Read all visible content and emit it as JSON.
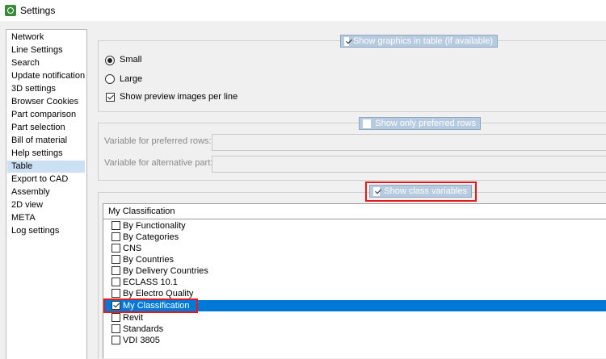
{
  "window": {
    "title": "Settings",
    "icon": "settings-gear-icon"
  },
  "sidebar": {
    "items": [
      {
        "label": "Network"
      },
      {
        "label": "Line Settings"
      },
      {
        "label": "Search"
      },
      {
        "label": "Update notification"
      },
      {
        "label": "3D settings"
      },
      {
        "label": "Browser Cookies"
      },
      {
        "label": "Part comparison"
      },
      {
        "label": "Part selection"
      },
      {
        "label": "Bill of material"
      },
      {
        "label": "Help settings"
      },
      {
        "label": "Table",
        "selected": true
      },
      {
        "label": "Export to CAD"
      },
      {
        "label": "Assembly"
      },
      {
        "label": "2D view"
      },
      {
        "label": "META"
      },
      {
        "label": "Log settings"
      }
    ]
  },
  "graphics_group": {
    "legend": "Show graphics in table (if available)",
    "legend_checked": true,
    "radio_small": "Small",
    "radio_large": "Large",
    "selected_size": "Small",
    "preview_checkbox": "Show preview images per line",
    "preview_checked": true
  },
  "preferred_group": {
    "legend": "Show only preferred rows",
    "legend_checked": false,
    "var_preferred_label": "Variable for preferred rows:",
    "var_preferred_value": "",
    "var_alt_label": "Variable for alternative part:",
    "var_alt_value": ""
  },
  "class_group": {
    "legend": "Show class variables",
    "legend_checked": true,
    "selected_classification": "My Classification",
    "items": [
      {
        "label": "By Functionality",
        "checked": false,
        "selected": false
      },
      {
        "label": "By Categories",
        "checked": false,
        "selected": false
      },
      {
        "label": "CNS",
        "checked": false,
        "selected": false
      },
      {
        "label": "By Countries",
        "checked": false,
        "selected": false
      },
      {
        "label": "By Delivery Countries",
        "checked": false,
        "selected": false
      },
      {
        "label": "ECLASS 10.1",
        "checked": false,
        "selected": false
      },
      {
        "label": "By Electro Quality",
        "checked": false,
        "selected": false
      },
      {
        "label": "My Classification",
        "checked": true,
        "selected": true
      },
      {
        "label": "Revit",
        "checked": false,
        "selected": false
      },
      {
        "label": "Standards",
        "checked": false,
        "selected": false
      },
      {
        "label": "VDI 3805",
        "checked": false,
        "selected": false
      }
    ]
  },
  "colors": {
    "selection": "#0078d7",
    "highlight": "#e21a1a",
    "legend_bg": "#b7cbe0"
  }
}
